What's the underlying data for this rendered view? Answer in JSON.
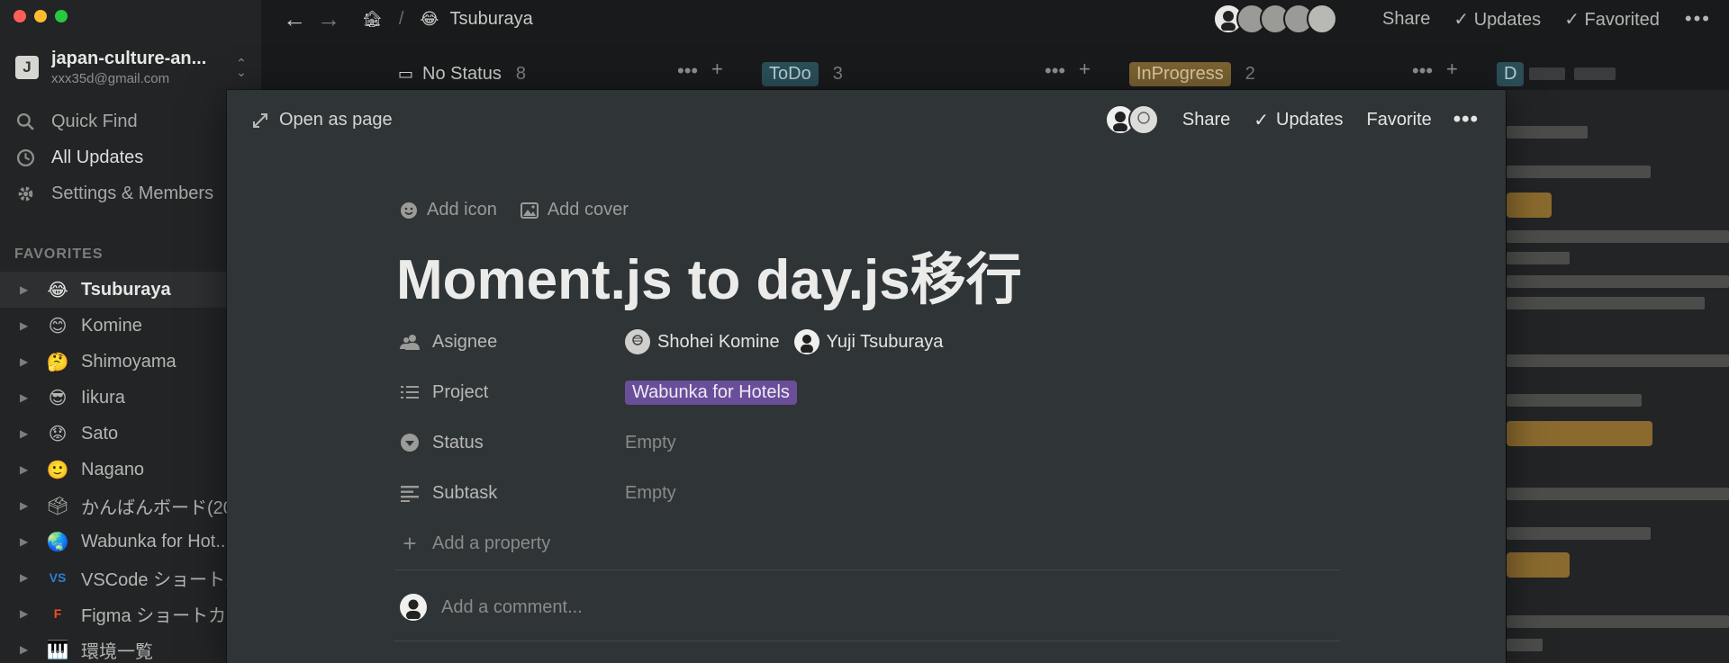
{
  "sidebar": {
    "workspace_badge": "J",
    "workspace_name": "japan-culture-an...",
    "workspace_email": "xxx35d@gmail.com",
    "nav": [
      {
        "label": "Quick Find",
        "icon": "search-icon"
      },
      {
        "label": "All Updates",
        "icon": "clock-icon"
      },
      {
        "label": "Settings & Members",
        "icon": "gear-icon"
      }
    ],
    "favorites_header": "FAVORITES",
    "favorites": [
      {
        "label": "Tsuburaya",
        "emoji": "😂"
      },
      {
        "label": "Komine",
        "emoji": "😊"
      },
      {
        "label": "Shimoyama",
        "emoji": "🤔"
      },
      {
        "label": "Iikura",
        "emoji": "😎"
      },
      {
        "label": "Sato",
        "emoji": "😟"
      },
      {
        "label": "Nagano",
        "emoji": "🙂"
      },
      {
        "label": "かんばんボード(20",
        "emoji": "🗳"
      },
      {
        "label": "Wabunka for Hot...",
        "emoji": "🌏"
      },
      {
        "label": "VSCode ショート...",
        "emoji": "VS"
      },
      {
        "label": "Figma ショートカ...",
        "emoji": "F"
      },
      {
        "label": "環境一覧",
        "emoji": "🎹"
      }
    ]
  },
  "topbar": {
    "back": "←",
    "forward": "→",
    "breadcrumb_sep": "/",
    "breadcrumb_page": "Tsuburaya",
    "share": "Share",
    "updates": "Updates",
    "favorited": "Favorited",
    "more": "•••"
  },
  "board": {
    "columns": [
      {
        "label": "No Status",
        "count": "8"
      },
      {
        "label": "ToDo",
        "count": "3"
      },
      {
        "label": "InProgress",
        "count": "2"
      },
      {
        "label": "D",
        "count": ""
      }
    ],
    "col_more": "•••",
    "col_add": "+"
  },
  "modal": {
    "open_as_page": "Open as page",
    "share": "Share",
    "updates": "Updates",
    "favorite": "Favorite",
    "more": "•••",
    "add_icon": "Add icon",
    "add_cover": "Add cover",
    "title": "Moment.js to day.js移行",
    "properties": {
      "asignee_label": "Asignee",
      "assignees": [
        "Shohei Komine",
        "Yuji Tsuburaya"
      ],
      "project_label": "Project",
      "project_value": "Wabunka for Hotels",
      "status_label": "Status",
      "status_value": "Empty",
      "subtask_label": "Subtask",
      "subtask_value": "Empty",
      "add_property": "Add a property"
    },
    "comment_placeholder": "Add a comment..."
  },
  "colors": {
    "app_bg": "#191a1c",
    "sidebar_bg": "#222426",
    "modal_bg": "#2f3437",
    "todo_tag": "#2b4f59",
    "inprogress_tag": "#7b6232",
    "project_tag": "#6a4e9a"
  }
}
